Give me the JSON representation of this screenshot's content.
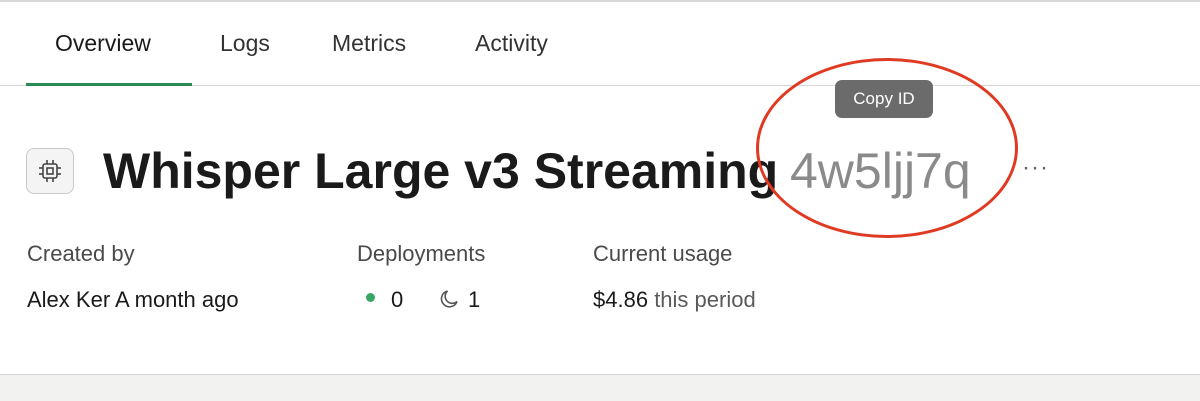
{
  "tabs": [
    {
      "label": "Overview",
      "active": true
    },
    {
      "label": "Logs",
      "active": false
    },
    {
      "label": "Metrics",
      "active": false
    },
    {
      "label": "Activity",
      "active": false
    }
  ],
  "model": {
    "icon": "chip-icon",
    "title": "Whisper Large v3 Streaming",
    "id": "4w5ljj7q",
    "more_label": "···"
  },
  "tooltip": {
    "text": "Copy ID"
  },
  "info": {
    "created_by": {
      "label": "Created by",
      "value": "Alex Ker A month ago"
    },
    "deployments": {
      "label": "Deployments",
      "active_count": "0",
      "sleeping_count": "1",
      "active_status_color": "#3aa665"
    },
    "usage": {
      "label": "Current usage",
      "amount": "$4.86",
      "suffix": "this period"
    }
  },
  "colors": {
    "accent": "#2a8a55",
    "highlight_ring": "#e03a22"
  }
}
